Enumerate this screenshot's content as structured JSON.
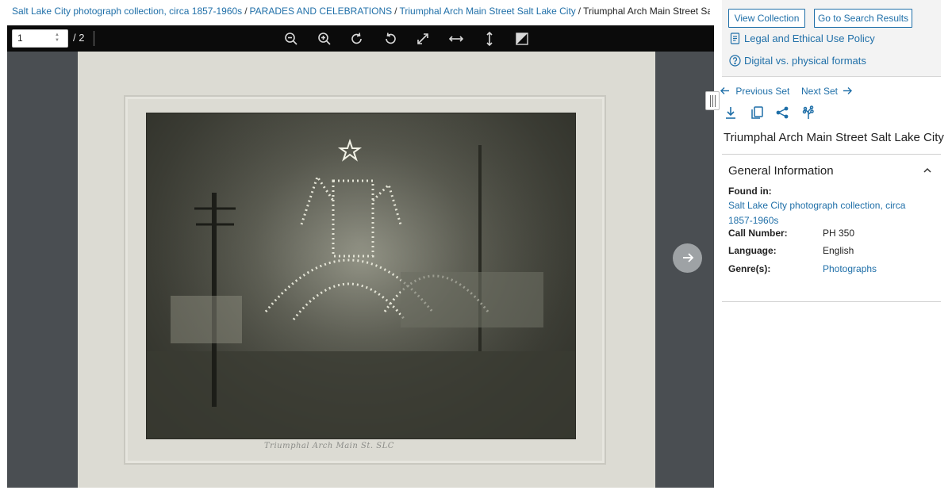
{
  "breadcrumb": {
    "items": [
      "Salt Lake City photograph collection, circa 1857-1960s",
      "PARADES AND CELEBRATIONS",
      "Triumphal Arch Main Street Salt Lake City"
    ],
    "current": "Triumphal Arch Main Street Salt Lake City",
    "separator": "/"
  },
  "viewer": {
    "page_value": "1",
    "page_total": "/ 2",
    "toolbar_icons": [
      "zoom-out-icon",
      "zoom-in-icon",
      "rotate-right-icon",
      "rotate-left-icon",
      "fullscreen-icon",
      "fit-width-icon",
      "fit-height-icon",
      "invert-colors-icon"
    ],
    "handwriting": "Triumphal Arch Main St. SLC"
  },
  "sidebar": {
    "view_collection": "View Collection",
    "search_results": "Go to Search Results",
    "legal_link": "Legal and Ethical Use Policy",
    "formats_link": "Digital vs. physical formats",
    "previous_set": "Previous Set",
    "next_set": "Next Set",
    "actions": [
      "download-icon",
      "copy-icon",
      "share-icon",
      "tree-icon"
    ],
    "title": "Triumphal Arch Main Street Salt Lake City",
    "section": "General Information",
    "found_in_label": "Found in:",
    "found_in_value": "Salt Lake City photograph collection, circa 1857-1960s",
    "call_number_label": "Call Number:",
    "call_number_value": "PH 350",
    "language_label": "Language:",
    "language_value": "English",
    "genre_label": "Genre(s):",
    "genre_value": "Photographs"
  },
  "colors": {
    "link": "#1f6fa8",
    "toolbar": "#0b0b0b",
    "viewer_bg": "#4a4e52"
  }
}
